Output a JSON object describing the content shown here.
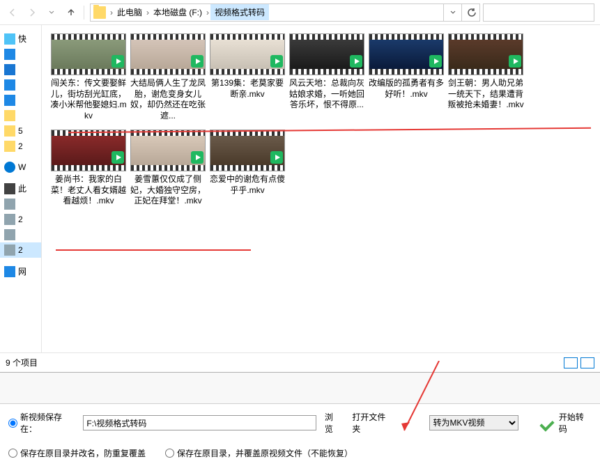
{
  "breadcrumb": {
    "item1": "此电脑",
    "item2": "本地磁盘 (F:)",
    "item3": "视频格式转码"
  },
  "sidebar": {
    "quick": "快",
    "items": [
      "",
      "",
      "",
      "",
      "5",
      "2"
    ],
    "wps": "W",
    "pc": "此",
    "item_n": "",
    "z1": "2",
    "z2": "2",
    "net": "网"
  },
  "files": [
    {
      "name": "闯关东：传文要娶鲜儿，街坊刮光缸底，凑小米帮他娶媳妇.mkv"
    },
    {
      "name": "大结局俩人生了龙凤胎，谢危变身女儿奴，却仍然还在吃张遮..."
    },
    {
      "name": "第139集：老莫家要断亲.mkv"
    },
    {
      "name": "风云天地：总裁向灰姑娘求婚，一听她回答乐坏，恨不得原..."
    },
    {
      "name": "改编版的孤勇者有多好听！.mkv"
    },
    {
      "name": "剑王朝：男人助兄弟一统天下，结果遭背叛被抢未婚妻！.mkv"
    },
    {
      "name": "姜尚书：我家的白菜！老丈人看女婿越看越烦！.mkv"
    },
    {
      "name": "姜雪蕙仅仅成了侧妃，大婚独守空房，正妃在拜堂！.mkv"
    },
    {
      "name": "恋爱中的谢危有点傻乎乎.mkv"
    }
  ],
  "status": {
    "count": "9 个项目"
  },
  "panel": {
    "save_at": "新视频保存在：",
    "path": "F:\\视频格式转码",
    "browse": "浏览",
    "open_folder": "打开文件夹",
    "rename_opt": "保存在原目录并改名，防重复覆盖",
    "overwrite_opt": "保存在原目录，并覆盖原视频文件（不能恢复）",
    "format": "转为MKV视频",
    "start": "开始转码"
  }
}
